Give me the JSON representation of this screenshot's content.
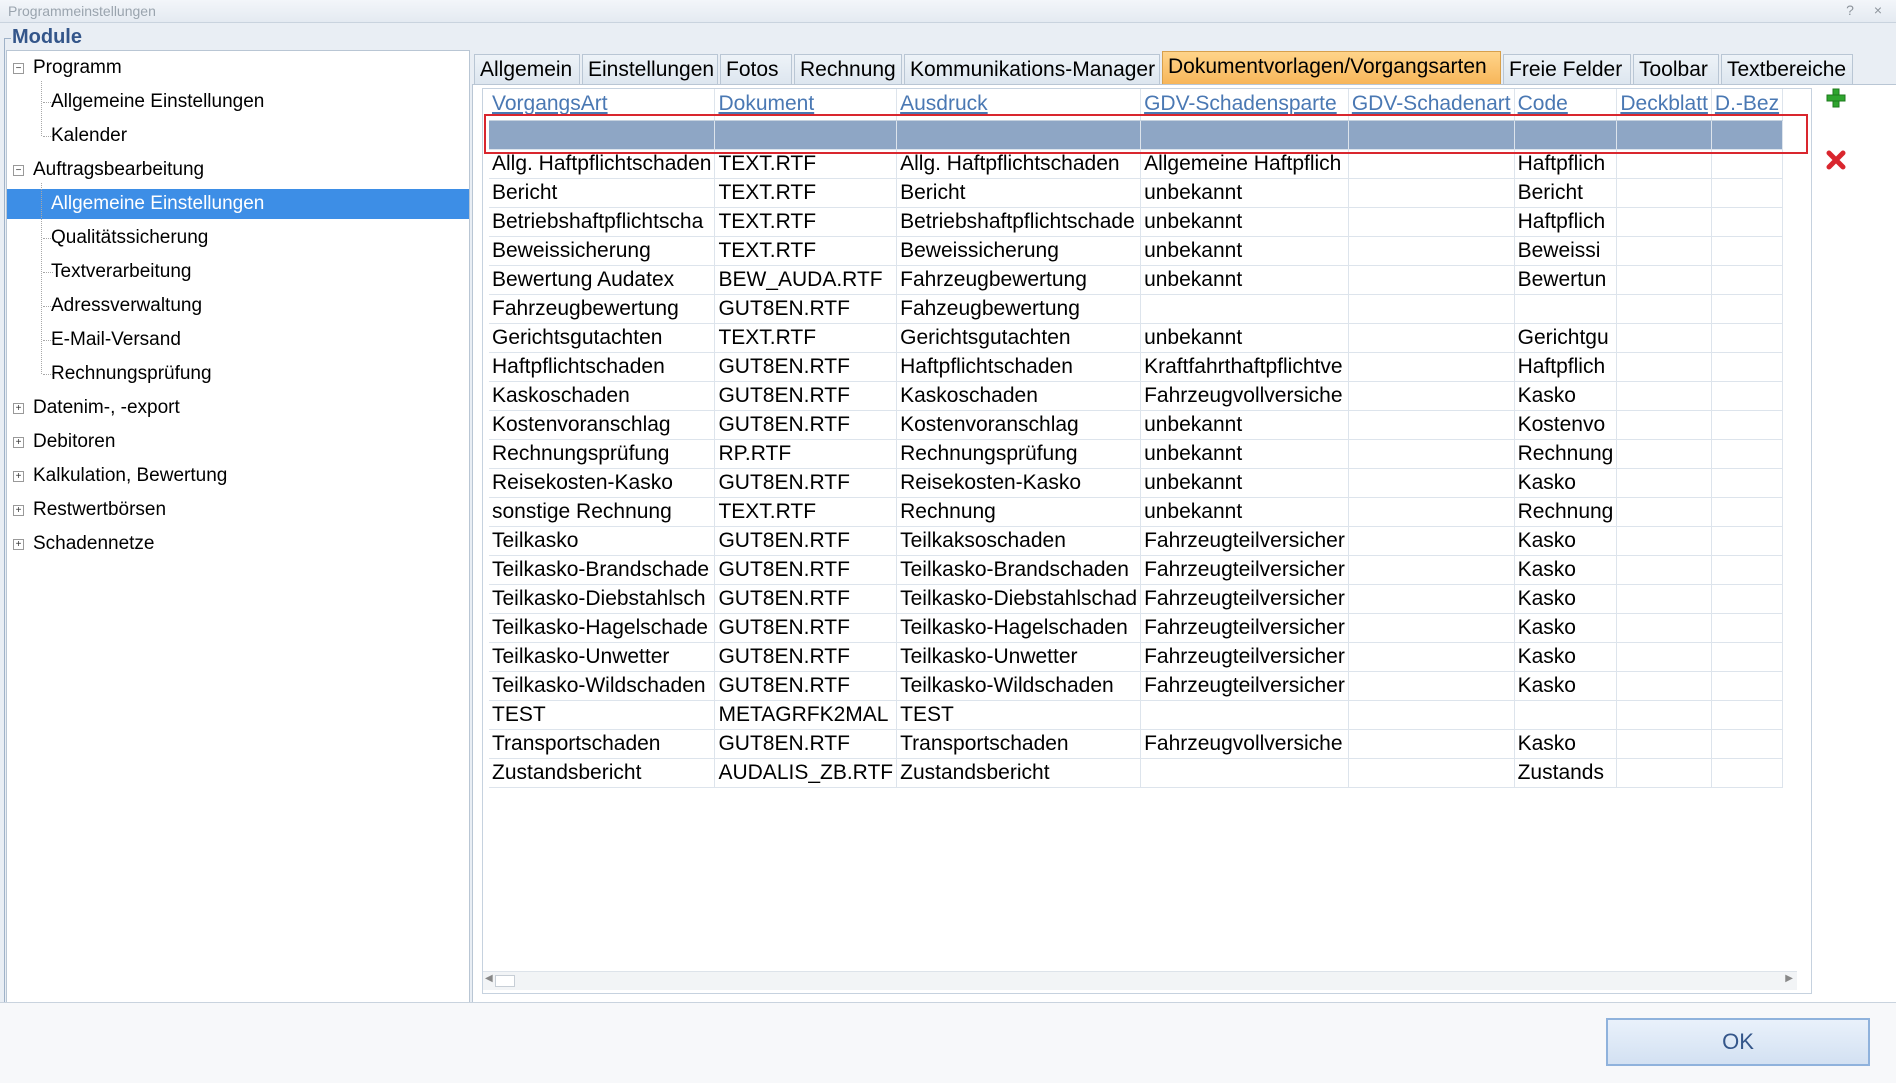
{
  "window": {
    "title": "Programmeinstellungen",
    "help": "?",
    "close": "×"
  },
  "section_label": "Module",
  "tree": {
    "items": [
      {
        "label": "Programm",
        "level": 0,
        "expander": "−"
      },
      {
        "label": "Allgemeine Einstellungen",
        "level": 1
      },
      {
        "label": "Kalender",
        "level": 1
      },
      {
        "label": "Auftragsbearbeitung",
        "level": 0,
        "expander": "−"
      },
      {
        "label": "Allgemeine Einstellungen",
        "level": 1,
        "selected": true
      },
      {
        "label": "Qualitätssicherung",
        "level": 1
      },
      {
        "label": "Textverarbeitung",
        "level": 1
      },
      {
        "label": "Adressverwaltung",
        "level": 1
      },
      {
        "label": "E-Mail-Versand",
        "level": 1
      },
      {
        "label": "Rechnungsprüfung",
        "level": 1
      },
      {
        "label": "Datenim-, -export",
        "level": 0,
        "expander": "+"
      },
      {
        "label": "Debitoren",
        "level": 0,
        "expander": "+"
      },
      {
        "label": "Kalkulation, Bewertung",
        "level": 0,
        "expander": "+"
      },
      {
        "label": "Restwertbörsen",
        "level": 0,
        "expander": "+"
      },
      {
        "label": "Schadennetze",
        "level": 0,
        "expander": "+"
      }
    ]
  },
  "tabs": [
    "Allgemein",
    "Einstellungen",
    "Fotos",
    "Rechnung",
    "Kommunikations-Manager",
    "Dokumentvorlagen/Vorgangsarten",
    "Freie Felder",
    "Toolbar",
    "Textbereiche"
  ],
  "active_tab": "Dokumentvorlagen/Vorgangsarten",
  "grid": {
    "columns": [
      "VorgangsArt",
      "Dokument",
      "Ausdruck",
      "GDV-Schadensparte",
      "GDV-Schadenart",
      "Code",
      "Deckblatt",
      "D.-Bez"
    ],
    "rows": [
      [
        "Allg. Haftpflichtschaden",
        "TEXT.RTF",
        "Allg. Haftpflichtschaden",
        "Allgemeine Haftpflich",
        "",
        "Haftpflich",
        "",
        ""
      ],
      [
        "Bericht",
        "TEXT.RTF",
        "Bericht",
        "unbekannt",
        "",
        "Bericht",
        "",
        ""
      ],
      [
        "Betriebshaftpflichtscha",
        "TEXT.RTF",
        "Betriebshaftpflichtschade",
        "unbekannt",
        "",
        "Haftpflich",
        "",
        ""
      ],
      [
        "Beweissicherung",
        "TEXT.RTF",
        "Beweissicherung",
        "unbekannt",
        "",
        "Beweissi",
        "",
        ""
      ],
      [
        "Bewertung Audatex",
        "BEW_AUDA.RTF",
        "Fahrzeugbewertung",
        "unbekannt",
        "",
        "Bewertun",
        "",
        ""
      ],
      [
        "Fahrzeugbewertung",
        "GUT8EN.RTF",
        "Fahzeugbewertung",
        "",
        "",
        "",
        "",
        ""
      ],
      [
        "Gerichtsgutachten",
        "TEXT.RTF",
        "Gerichtsgutachten",
        "unbekannt",
        "",
        "Gerichtgu",
        "",
        ""
      ],
      [
        "Haftpflichtschaden",
        "GUT8EN.RTF",
        "Haftpflichtschaden",
        "Kraftfahrthaftpflichtve",
        "",
        "Haftpflich",
        "",
        ""
      ],
      [
        "Kaskoschaden",
        "GUT8EN.RTF",
        "Kaskoschaden",
        "Fahrzeugvollversiche",
        "",
        "Kasko",
        "",
        ""
      ],
      [
        "Kostenvoranschlag",
        "GUT8EN.RTF",
        "Kostenvoranschlag",
        "unbekannt",
        "",
        "Kostenvo",
        "",
        ""
      ],
      [
        "Rechnungsprüfung",
        "RP.RTF",
        "Rechnungsprüfung",
        "unbekannt",
        "",
        "Rechnung",
        "",
        ""
      ],
      [
        "Reisekosten-Kasko",
        "GUT8EN.RTF",
        "Reisekosten-Kasko",
        "unbekannt",
        "",
        "Kasko",
        "",
        ""
      ],
      [
        "sonstige Rechnung",
        "TEXT.RTF",
        "Rechnung",
        "unbekannt",
        "",
        "Rechnung",
        "",
        ""
      ],
      [
        "Teilkasko",
        "GUT8EN.RTF",
        "Teilkaksoschaden",
        "Fahrzeugteilversicher",
        "",
        "Kasko",
        "",
        ""
      ],
      [
        "Teilkasko-Brandschade",
        "GUT8EN.RTF",
        "Teilkasko-Brandschaden",
        "Fahrzeugteilversicher",
        "",
        "Kasko",
        "",
        ""
      ],
      [
        "Teilkasko-Diebstahlsch",
        "GUT8EN.RTF",
        "Teilkasko-Diebstahlschad",
        "Fahrzeugteilversicher",
        "",
        "Kasko",
        "",
        ""
      ],
      [
        "Teilkasko-Hagelschade",
        "GUT8EN.RTF",
        "Teilkasko-Hagelschaden",
        "Fahrzeugteilversicher",
        "",
        "Kasko",
        "",
        ""
      ],
      [
        "Teilkasko-Unwetter",
        "GUT8EN.RTF",
        "Teilkasko-Unwetter",
        "Fahrzeugteilversicher",
        "",
        "Kasko",
        "",
        ""
      ],
      [
        "Teilkasko-Wildschaden",
        "GUT8EN.RTF",
        "Teilkasko-Wildschaden",
        "Fahrzeugteilversicher",
        "",
        "Kasko",
        "",
        ""
      ],
      [
        "TEST",
        "METAGRFK2MAL",
        "TEST",
        "",
        "",
        "",
        "",
        ""
      ],
      [
        "Transportschaden",
        "GUT8EN.RTF",
        "Transportschaden",
        "Fahrzeugvollversiche",
        "",
        "Kasko",
        "",
        ""
      ],
      [
        "Zustandsbericht",
        "AUDALIS_ZB.RTF",
        "Zustandsbericht",
        "",
        "",
        "Zustands",
        "",
        ""
      ]
    ]
  },
  "icons": {
    "add": "plus-icon",
    "delete": "x-icon",
    "add_color": "#2ea52e",
    "delete_color": "#d9262e"
  },
  "footer": {
    "ok_label": "OK"
  },
  "colors": {
    "selection": "#3d8ee6",
    "active_tab": "#f7b65a",
    "new_row": "#8ea6c5",
    "highlight_frame": "#d9262e"
  }
}
